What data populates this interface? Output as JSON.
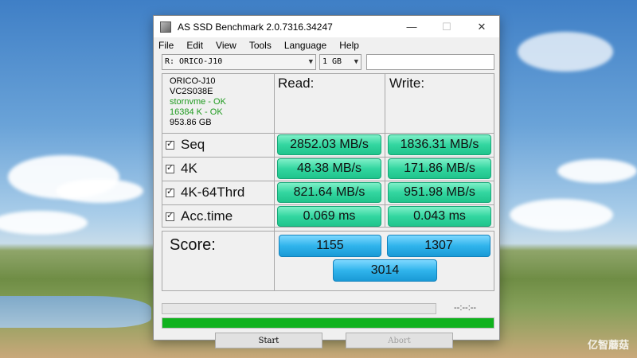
{
  "window": {
    "title": "AS SSD Benchmark 2.0.7316.34247",
    "minimize": "—",
    "maximize": "☐",
    "close": "✕"
  },
  "menu": [
    "File",
    "Edit",
    "View",
    "Tools",
    "Language",
    "Help"
  ],
  "toolbar": {
    "drive": "R: ORICO-J10",
    "size": "1 GB",
    "text_value": ""
  },
  "info": {
    "name": "ORICO-J10",
    "firmware": "VC2S038E",
    "driver": "stornvme - OK",
    "alignment": "16384 K - OK",
    "capacity": "953.86 GB"
  },
  "headers": {
    "read": "Read:",
    "write": "Write:"
  },
  "rows": [
    {
      "label": "Seq",
      "read": "2852.03 MB/s",
      "write": "1836.31 MB/s"
    },
    {
      "label": "4K",
      "read": "48.38 MB/s",
      "write": "171.86 MB/s"
    },
    {
      "label": "4K-64Thrd",
      "read": "821.64 MB/s",
      "write": "951.98 MB/s"
    },
    {
      "label": "Acc.time",
      "read": "0.069 ms",
      "write": "0.043 ms"
    }
  ],
  "score": {
    "label": "Score:",
    "read": "1155",
    "write": "1307",
    "total": "3014"
  },
  "status": {
    "time": "--:--:--",
    "progress_fraction": 1.0
  },
  "buttons": {
    "start": "Start",
    "abort": "Abort"
  },
  "watermark": "亿智蘑菇",
  "colors": {
    "result_green": "#33d6a0",
    "score_blue": "#30b4ec",
    "progress_green": "#10b21e",
    "ok_green": "#1f9a1f"
  }
}
